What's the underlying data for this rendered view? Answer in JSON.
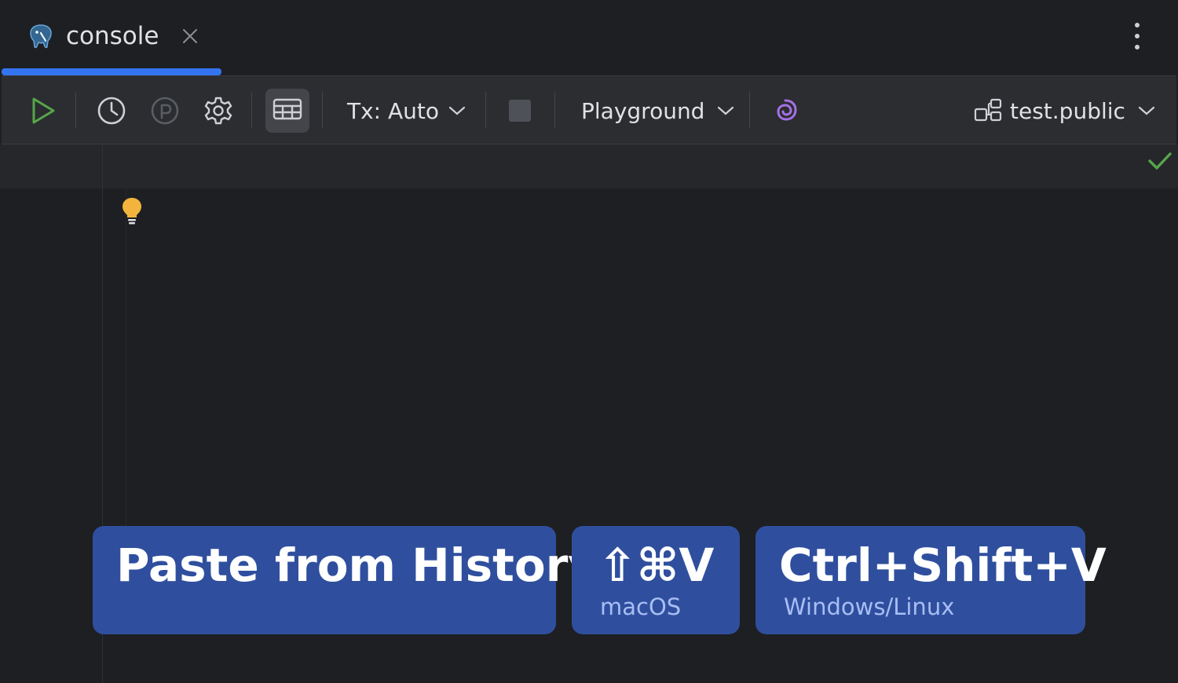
{
  "tab": {
    "label": "console",
    "icon": "postgresql-elephant-icon",
    "active_underline_color": "#3574f0"
  },
  "toolbar": {
    "tx_label": "Tx: Auto",
    "playground_label": "Playground",
    "schema_label": "test.public",
    "run_color": "#57a64a",
    "ai_color": "#a571e6"
  },
  "editor": {
    "status_ok_color": "#57a64a",
    "bulb_color": "#f2b43c"
  },
  "shortcut": {
    "action": "Paste from History",
    "mac_keys": "⇧⌘V",
    "mac_os": "macOS",
    "win_keys": "Ctrl+Shift+V",
    "win_os": "Windows/Linux"
  }
}
